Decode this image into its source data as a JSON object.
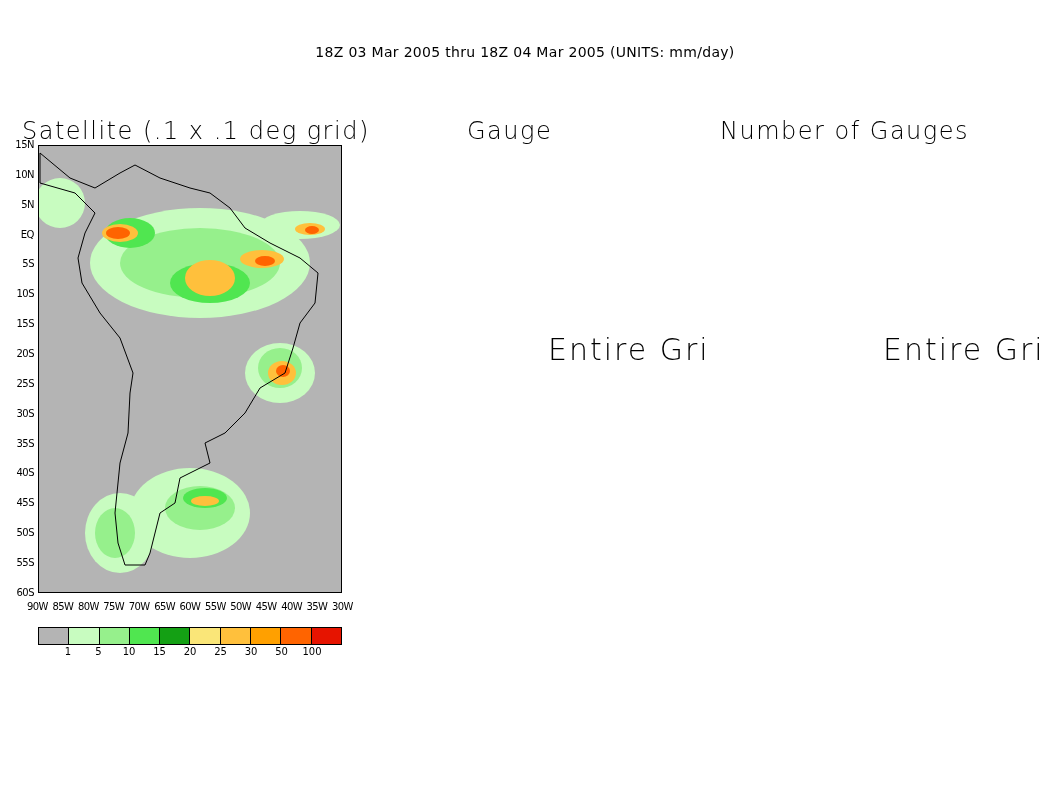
{
  "title": "18Z 03 Mar 2005 thru 18Z 04 Mar 2005 (UNITS: mm/day)",
  "panels": [
    {
      "kind": "map",
      "title": "Satellite (.1 x .1 deg grid)",
      "lat_labels": [
        "15N",
        "10N",
        "5N",
        "EQ",
        "5S",
        "10S",
        "15S",
        "20S",
        "25S",
        "30S",
        "35S",
        "40S",
        "45S",
        "50S",
        "55S",
        "60S"
      ],
      "lon_labels": [
        "90W",
        "85W",
        "80W",
        "75W",
        "70W",
        "65W",
        "60W",
        "55W",
        "50W",
        "45W",
        "40W",
        "35W",
        "30W"
      ],
      "legend": {
        "swatches": [
          {
            "color": "#b4b4b4"
          },
          {
            "color": "#c8fcc0"
          },
          {
            "color": "#96f08c"
          },
          {
            "color": "#50e650"
          },
          {
            "color": "#14a014"
          },
          {
            "color": "#fae678"
          },
          {
            "color": "#ffc03c"
          },
          {
            "color": "#ffa000"
          },
          {
            "color": "#ff6400"
          },
          {
            "color": "#e61400"
          }
        ],
        "labels": [
          "1",
          "5",
          "10",
          "15",
          "20",
          "25",
          "30",
          "50",
          "100"
        ]
      }
    },
    {
      "kind": "empty",
      "title": "Gauge",
      "message": "Entire Gri"
    },
    {
      "kind": "empty",
      "title": "Number of Gauges",
      "message": "Entire Gri"
    }
  ]
}
